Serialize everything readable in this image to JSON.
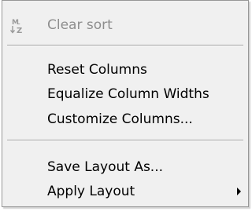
{
  "menu": {
    "clear_sort": {
      "label": "Clear sort",
      "icon": "sort-clear-icon",
      "disabled": true
    },
    "reset_columns": {
      "label": "Reset Columns"
    },
    "equalize_widths": {
      "label": "Equalize Column Widths"
    },
    "customize_columns": {
      "label": "Customize Columns..."
    },
    "save_layout": {
      "label": "Save Layout As..."
    },
    "apply_layout": {
      "label": "Apply Layout",
      "submenu_icon": "submenu-arrow-icon"
    }
  }
}
